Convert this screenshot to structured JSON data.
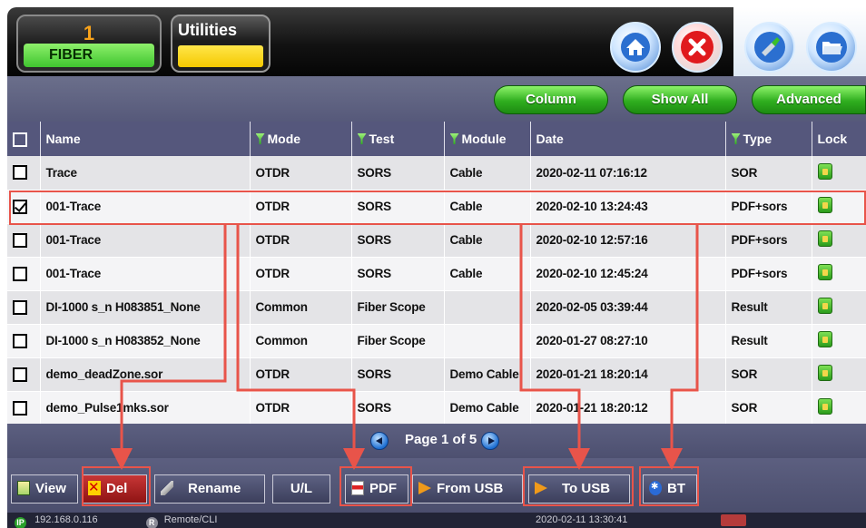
{
  "header": {
    "fiber_tab": {
      "number": "1",
      "label": "FIBER"
    },
    "utilities_tab": {
      "label": "Utilities"
    },
    "icons": [
      "home-icon",
      "close-icon",
      "clean-icon",
      "folder-icon"
    ]
  },
  "toolbar": {
    "column_label": "Column",
    "show_all_label": "Show All",
    "advanced_label": "Advanced"
  },
  "table": {
    "columns": [
      "Name",
      "Mode",
      "Test",
      "Module",
      "Date",
      "Type",
      "Lock"
    ],
    "rows": [
      {
        "checked": false,
        "name": "Trace",
        "mode": "OTDR",
        "test": "SORS",
        "module": "Cable",
        "date": "2020-02-11 07:16:12",
        "type": "SOR"
      },
      {
        "checked": true,
        "name": "001-Trace",
        "mode": "OTDR",
        "test": "SORS",
        "module": "Cable",
        "date": "2020-02-10 13:24:43",
        "type": "PDF+sors"
      },
      {
        "checked": false,
        "name": "001-Trace",
        "mode": "OTDR",
        "test": "SORS",
        "module": "Cable",
        "date": "2020-02-10 12:57:16",
        "type": "PDF+sors"
      },
      {
        "checked": false,
        "name": "001-Trace",
        "mode": "OTDR",
        "test": "SORS",
        "module": "Cable",
        "date": "2020-02-10 12:45:24",
        "type": "PDF+sors"
      },
      {
        "checked": false,
        "name": "DI-1000 s_n H083851_None",
        "mode": "Common",
        "test": "Fiber Scope",
        "module": "",
        "date": "2020-02-05 03:39:44",
        "type": "Result"
      },
      {
        "checked": false,
        "name": "DI-1000 s_n H083852_None",
        "mode": "Common",
        "test": "Fiber Scope",
        "module": "",
        "date": "2020-01-27 08:27:10",
        "type": "Result"
      },
      {
        "checked": false,
        "name": "demo_deadZone.sor",
        "mode": "OTDR",
        "test": "SORS",
        "module": "Demo Cable",
        "date": "2020-01-21 18:20:14",
        "type": "SOR"
      },
      {
        "checked": false,
        "name": "demo_Pulse1mks.sor",
        "mode": "OTDR",
        "test": "SORS",
        "module": "Demo Cable",
        "date": "2020-01-21 18:20:12",
        "type": "SOR"
      }
    ]
  },
  "pager": {
    "text": "Page 1 of 5"
  },
  "actions": {
    "view": "View",
    "del": "Del",
    "rename": "Rename",
    "ul": "U/L",
    "pdf": "PDF",
    "from_usb": "From USB",
    "to_usb": "To USB",
    "bt": "BT"
  },
  "status": {
    "ip_badge": "IP",
    "ip": "192.168.0.116",
    "remote_badge": "R",
    "remote": "Remote/CLI",
    "datetime": "2020-02-11 13:30:41"
  },
  "colors": {
    "annotation": "#e8544a",
    "header_bg": "#55577c",
    "accent_green": "#2fae1f",
    "tab_yellow": "#f5c900"
  }
}
